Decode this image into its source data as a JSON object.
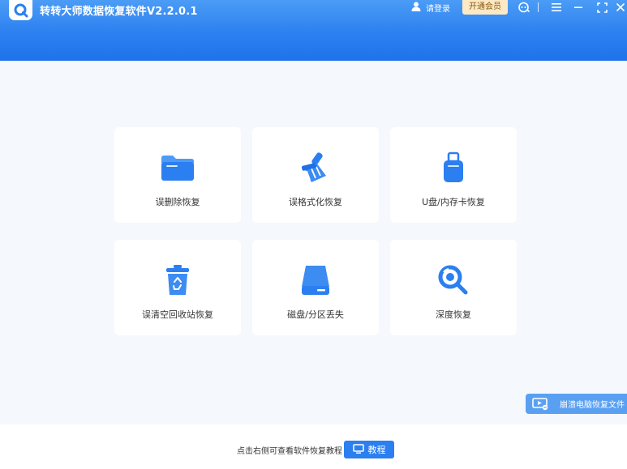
{
  "app": {
    "title": "转转大师数据恢复软件V2.2.0.1",
    "accent_color": "#2b7ff0"
  },
  "header": {
    "user_label": "请登录",
    "vip_label": "开通会员",
    "icons": [
      "support-icon",
      "menu-icon",
      "minimize-icon",
      "maximize-icon",
      "close-icon"
    ]
  },
  "modes": [
    {
      "label": "误删除恢复",
      "icon": "folder-icon"
    },
    {
      "label": "误格式化恢复",
      "icon": "broom-icon"
    },
    {
      "label": "U盘/内存卡恢复",
      "icon": "usb-drive-icon"
    },
    {
      "label": "误清空回收站恢复",
      "icon": "recycle-bin-icon"
    },
    {
      "label": "磁盘/分区丢失",
      "icon": "hard-disk-icon"
    },
    {
      "label": "深度恢复",
      "icon": "deep-scan-icon"
    }
  ],
  "side_badge": {
    "label": "崩溃电脑恢复文件"
  },
  "footer": {
    "hint": "点击右侧可查看软件恢复教程",
    "tutorial_label": "教程"
  }
}
